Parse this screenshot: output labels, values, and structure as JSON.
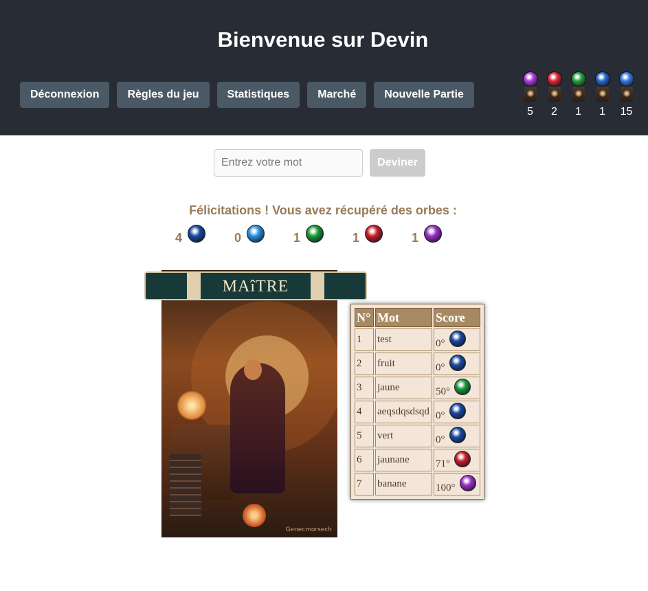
{
  "header": {
    "title": "Bienvenue sur Devin",
    "nav": [
      "Déconnexion",
      "Règles du jeu",
      "Statistiques",
      "Marché",
      "Nouvelle Partie"
    ],
    "inventory": [
      {
        "icon": "purple-orb-stand-icon",
        "color": "#b040e0",
        "count": "5"
      },
      {
        "icon": "red-orb-stand-icon",
        "color": "#e02a3a",
        "count": "2"
      },
      {
        "icon": "green-orb-stand-icon",
        "color": "#2aa040",
        "count": "1"
      },
      {
        "icon": "blue-orb-stand-icon",
        "color": "#2a6ad0",
        "count": "1"
      },
      {
        "icon": "orange-blue-orb-stand-icon",
        "color": "#3a7ae0",
        "count": "15"
      }
    ]
  },
  "guess": {
    "placeholder": "Entrez votre mot",
    "button": "Deviner"
  },
  "rewards": {
    "message": "Félicitations ! Vous avez récupéré des orbes :",
    "items": [
      {
        "count": "4",
        "icon": "dark-blue-orb-icon",
        "color": "#1a4aa0"
      },
      {
        "count": "0",
        "icon": "light-blue-orb-icon",
        "color": "#2a90e0"
      },
      {
        "count": "1",
        "icon": "green-orb-icon",
        "color": "#1a9a3a"
      },
      {
        "count": "1",
        "icon": "red-orb-icon",
        "color": "#c8202a"
      },
      {
        "count": "1",
        "icon": "purple-orb-icon",
        "color": "#9a30c8"
      }
    ]
  },
  "card": {
    "banner": "MAîTRE",
    "signature": "Genecmorsech"
  },
  "table": {
    "headers": [
      "N°",
      "Mot",
      "Score"
    ],
    "rows": [
      {
        "num": "1",
        "word": "test",
        "score": "0°",
        "icon": "dark-blue-orb-icon",
        "color": "#1a4aa0"
      },
      {
        "num": "2",
        "word": "fruit",
        "score": "0°",
        "icon": "dark-blue-orb-icon",
        "color": "#1a4aa0"
      },
      {
        "num": "3",
        "word": "jaune",
        "score": "50°",
        "icon": "green-orb-icon",
        "color": "#1a9a3a"
      },
      {
        "num": "4",
        "word": "aeqsdqsdsqd",
        "score": "0°",
        "icon": "dark-blue-orb-icon",
        "color": "#1a4aa0"
      },
      {
        "num": "5",
        "word": "vert",
        "score": "0°",
        "icon": "dark-blue-orb-icon",
        "color": "#1a4aa0"
      },
      {
        "num": "6",
        "word": "jaunane",
        "score": "71°",
        "icon": "red-orb-icon",
        "color": "#c8202a"
      },
      {
        "num": "7",
        "word": "banane",
        "score": "100°",
        "icon": "purple-orb-icon",
        "color": "#9a30c8"
      }
    ]
  }
}
